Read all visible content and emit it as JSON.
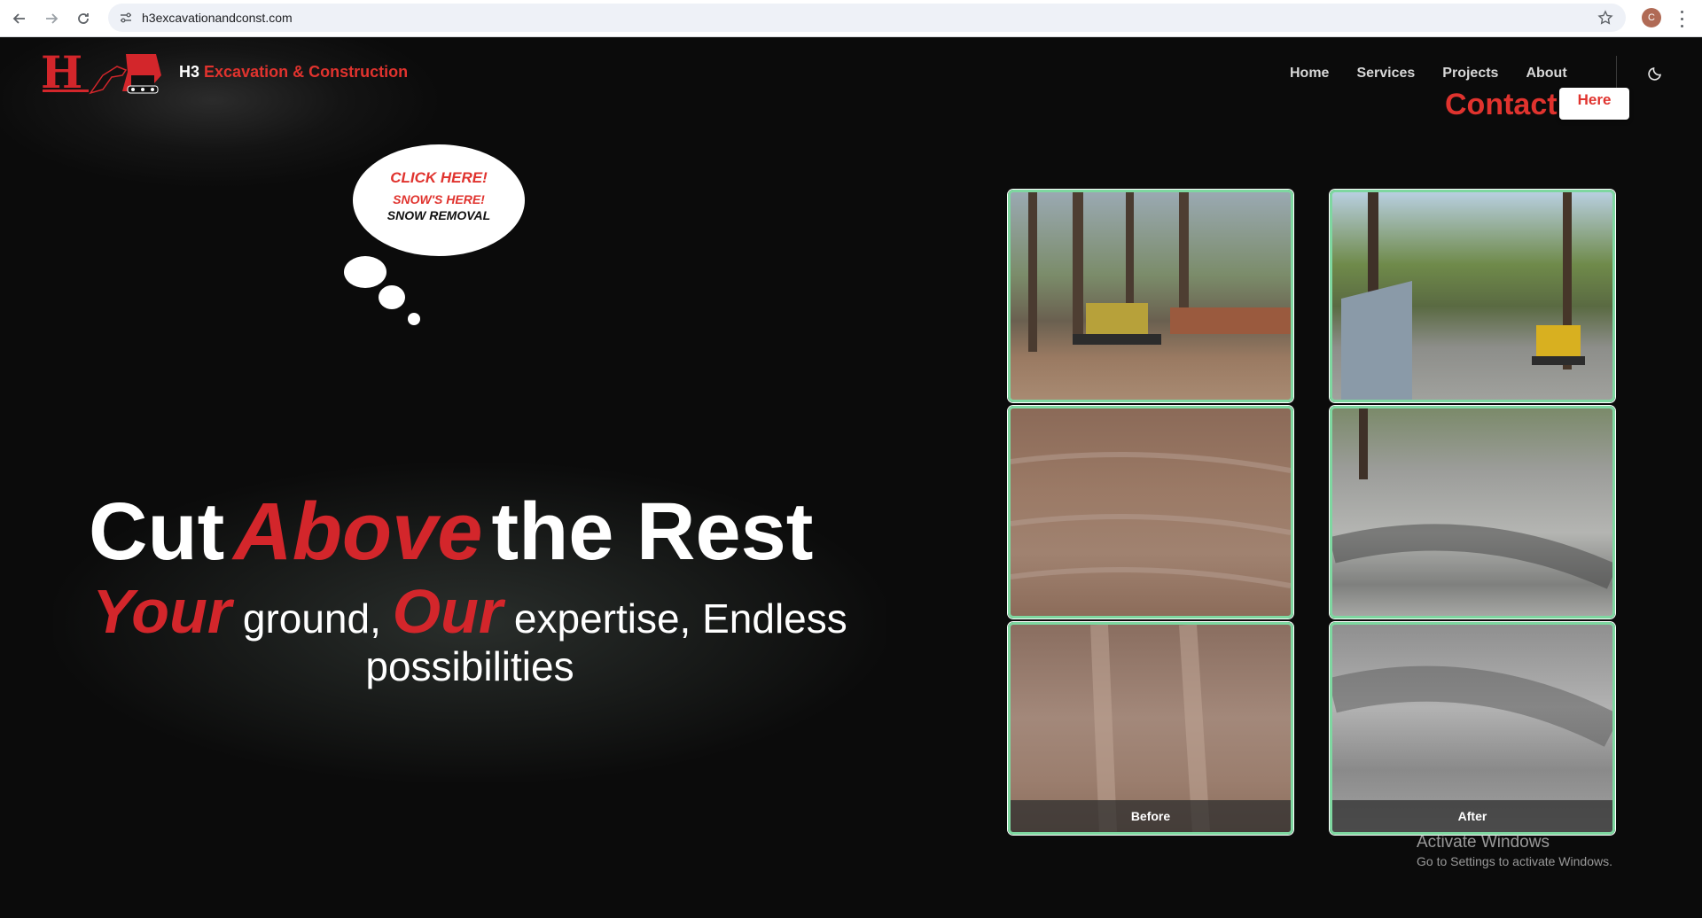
{
  "browser": {
    "url": "h3excavationandconst.com",
    "profile_initial": "C"
  },
  "header": {
    "brand_prefix": "H3",
    "brand_name": "Excavation & Construction",
    "nav": [
      "Home",
      "Services",
      "Projects",
      "About"
    ],
    "contact_label": "Contact",
    "here_label": "Here"
  },
  "bubble": {
    "line1": "CLICK HERE!",
    "line2": "SNOW'S HERE!",
    "line3": "SNOW REMOVAL"
  },
  "hero": {
    "headline_part1": "Cut",
    "headline_accent": "Above",
    "headline_part2": "the Rest",
    "sub_accent1": "Your",
    "sub_part1": "ground,",
    "sub_accent2": "Our",
    "sub_part2": "expertise, Endless possibilities"
  },
  "gallery": {
    "before_label": "Before",
    "after_label": "After"
  },
  "watermark": {
    "title": "Activate Windows",
    "subtitle": "Go to Settings to activate Windows."
  },
  "colors": {
    "accent_red": "#e0332e",
    "background": "#0b0b0b",
    "photo_border": "#7ed7a0"
  }
}
